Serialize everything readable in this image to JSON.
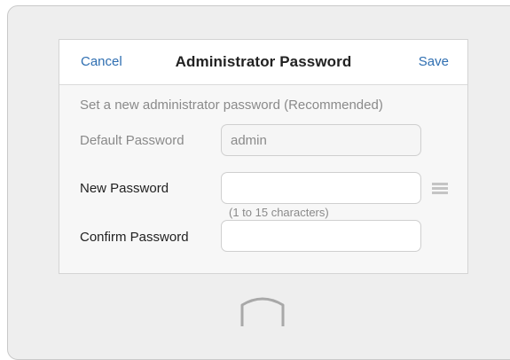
{
  "header": {
    "cancel_label": "Cancel",
    "title": "Administrator Password",
    "save_label": "Save"
  },
  "intro_text": "Set a new administrator password (Recommended)",
  "default_password": {
    "label": "Default Password",
    "value": "admin"
  },
  "new_password": {
    "label": "New Password",
    "value": "",
    "hint": "(1 to 15 characters)"
  },
  "confirm_password": {
    "label": "Confirm Password",
    "value": ""
  },
  "icons": {
    "menu": "menu-icon",
    "home": "home-icon"
  },
  "colors": {
    "accent": "#2e6eb1",
    "device_bg": "#eeeeee",
    "dialog_bg": "#f7f7f7",
    "muted_text": "#8a8a8a"
  }
}
